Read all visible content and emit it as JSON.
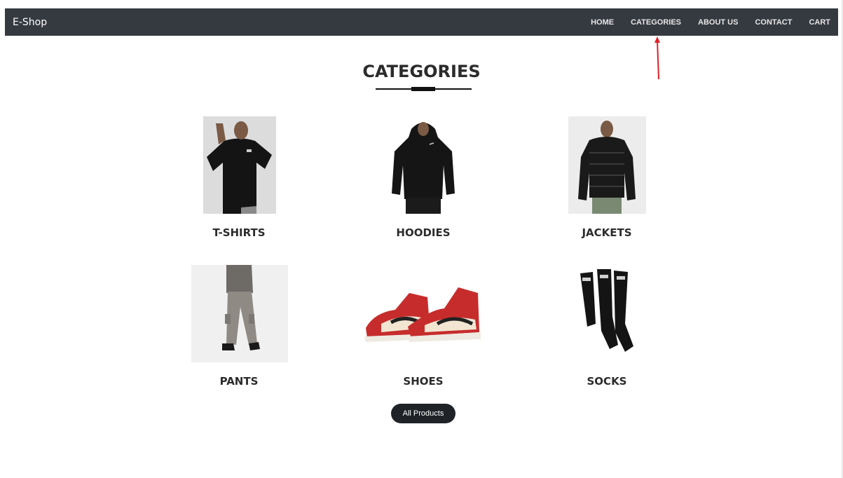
{
  "nav": {
    "brand": "E-Shop",
    "links": [
      {
        "label": "HOME"
      },
      {
        "label": "CATEGORIES"
      },
      {
        "label": "ABOUT US"
      },
      {
        "label": "CONTACT"
      },
      {
        "label": "CART"
      }
    ]
  },
  "page": {
    "title": "CATEGORIES"
  },
  "categories": [
    {
      "label": "T-SHIRTS",
      "icon": "tshirt-image"
    },
    {
      "label": "HOODIES",
      "icon": "hoodie-image"
    },
    {
      "label": "JACKETS",
      "icon": "jacket-image"
    },
    {
      "label": "PANTS",
      "icon": "pants-image"
    },
    {
      "label": "SHOES",
      "icon": "shoes-image"
    },
    {
      "label": "SOCKS",
      "icon": "socks-image"
    }
  ],
  "actions": {
    "all_products_label": "All Products"
  },
  "colors": {
    "navbar": "#353a40",
    "annotation_arrow": "#e0202a",
    "button": "#1f2327"
  }
}
